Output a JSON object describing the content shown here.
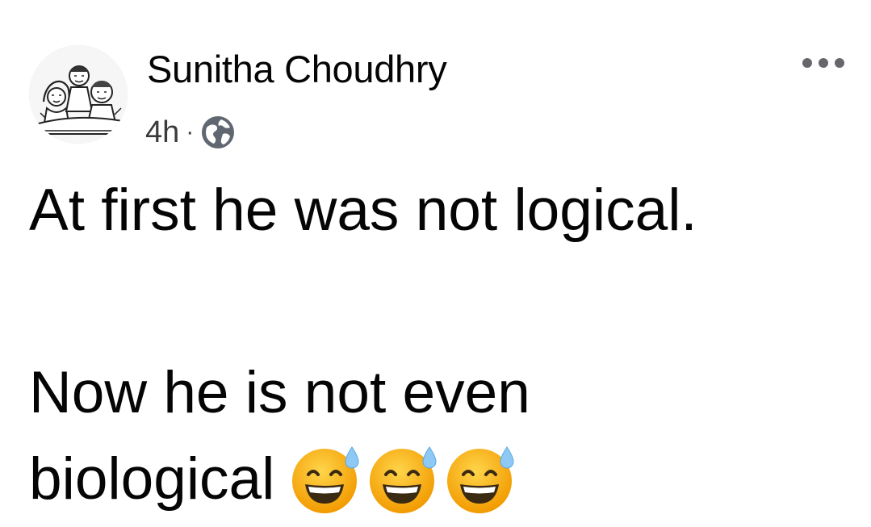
{
  "post": {
    "author_name": "Sunitha Choudhry",
    "timestamp": "4h",
    "separator": "·",
    "audience_icon": "globe-icon",
    "more_icon": "more-options-icon",
    "text_line1": "At first he was not logical.",
    "text_line2": "Now he is not even",
    "text_line3": "biological",
    "emoji_name": "grinning-face-with-sweat-emoji",
    "emoji_count": 3,
    "emoji_color": "#F7B500"
  }
}
